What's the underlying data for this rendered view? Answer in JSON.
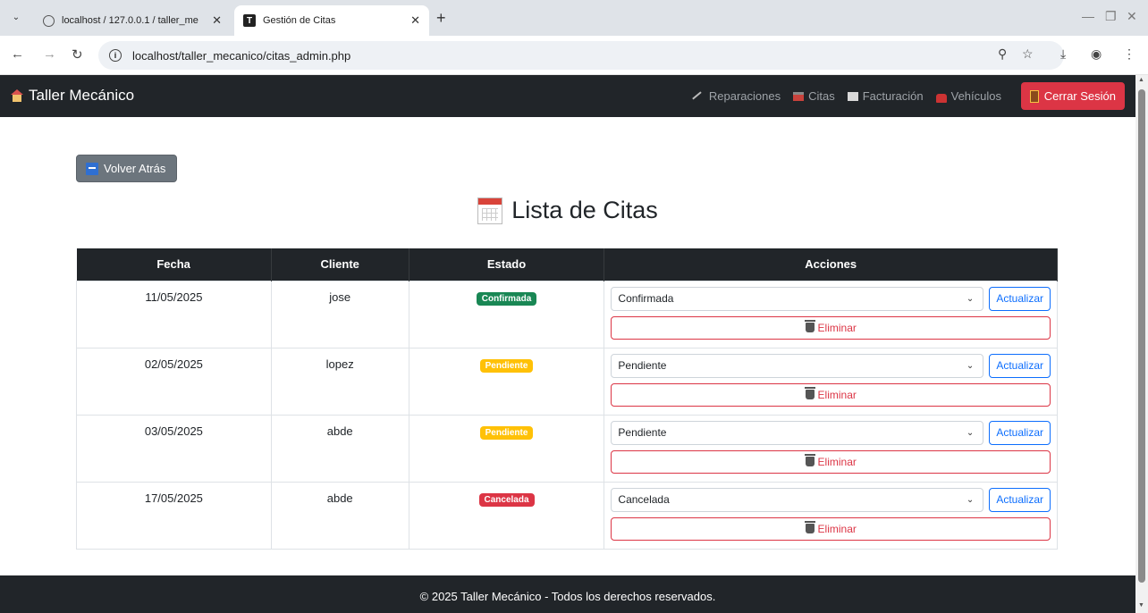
{
  "browser": {
    "tabs": [
      {
        "title": "localhost / 127.0.0.1 / taller_me",
        "active": false
      },
      {
        "title": "Gestión de Citas",
        "active": true
      }
    ],
    "url": "localhost/taller_mecanico/citas_admin.php"
  },
  "navbar": {
    "brand": "Taller Mecánico",
    "links": [
      "Reparaciones",
      "Citas",
      "Facturación",
      "Vehículos"
    ],
    "logout": "Cerrar Sesión"
  },
  "page": {
    "back_label": "Volver Atrás",
    "title": "Lista de Citas"
  },
  "table": {
    "headers": [
      "Fecha",
      "Cliente",
      "Estado",
      "Acciones"
    ],
    "update_label": "Actualizar",
    "delete_label": "Eliminar",
    "rows": [
      {
        "fecha": "11/05/2025",
        "cliente": "jose",
        "estado": "Confirmada",
        "estado_color": "#198754",
        "select": "Confirmada"
      },
      {
        "fecha": "02/05/2025",
        "cliente": "lopez",
        "estado": "Pendiente",
        "estado_color": "#ffc107",
        "select": "Pendiente"
      },
      {
        "fecha": "03/05/2025",
        "cliente": "abde",
        "estado": "Pendiente",
        "estado_color": "#ffc107",
        "select": "Pendiente"
      },
      {
        "fecha": "17/05/2025",
        "cliente": "abde",
        "estado": "Cancelada",
        "estado_color": "#dc3545",
        "select": "Cancelada"
      }
    ]
  },
  "footer": {
    "text": "© 2025 Taller Mecánico - Todos los derechos reservados."
  }
}
